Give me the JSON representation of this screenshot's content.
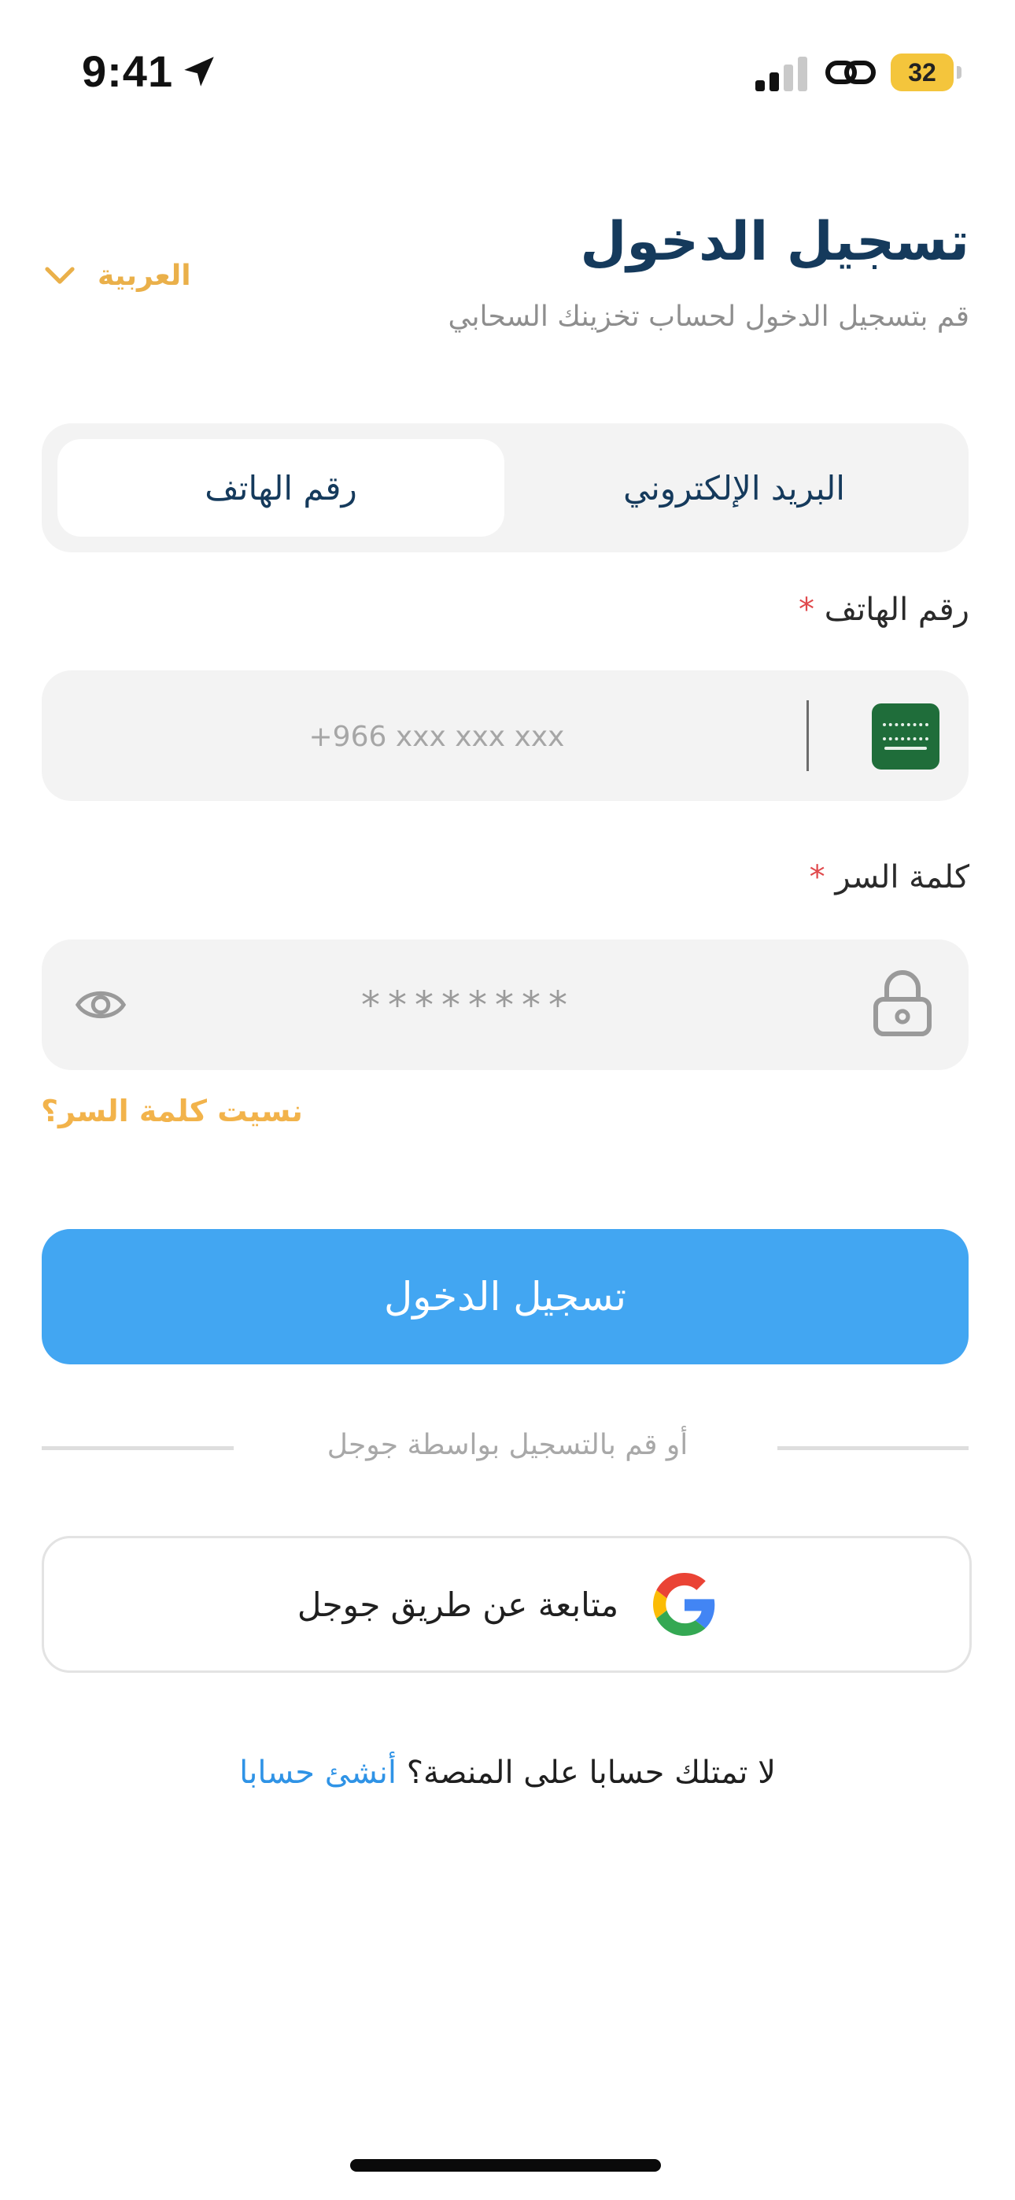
{
  "status_bar": {
    "time": "9:41",
    "battery": "32"
  },
  "header": {
    "title": "تسجيل الدخول",
    "subtitle": "قم بتسجيل الدخول لحساب تخزينك السحابي",
    "language": "العربية"
  },
  "tabs": [
    {
      "label": "البريد الإلكتروني",
      "active": false
    },
    {
      "label": "رقم الهاتف",
      "active": true
    }
  ],
  "phone_field": {
    "label": "رقم الهاتف",
    "required_mark": "*",
    "placeholder": "+966 xxx xxx xxx",
    "value": "",
    "country_flag": "saudi-arabia"
  },
  "password_field": {
    "label": "كلمة السر",
    "required_mark": "*",
    "placeholder": "********",
    "value": ""
  },
  "forgot_password": "نسيت كلمة السر؟",
  "login_button": "تسجيل الدخول",
  "separator_text": "أو قم بالتسجيل بواسطة جوجل",
  "google_button": "متابعة عن طريق جوجل",
  "signup": {
    "prompt": "لا تمتلك حسابا على المنصة؟ ",
    "link": "أنشئ حسابا"
  },
  "colors": {
    "primary": "#42a6f2",
    "title": "#153a5c",
    "accent": "#f2b34b",
    "required": "#e0494c",
    "link": "#2f93e6",
    "field_bg": "#f3f3f3"
  },
  "icons": [
    "location-arrow-icon",
    "signal-icon",
    "link-icon",
    "battery-icon",
    "chevron-down-icon",
    "saudi-flag-icon",
    "eye-icon",
    "lock-icon",
    "google-icon"
  ]
}
